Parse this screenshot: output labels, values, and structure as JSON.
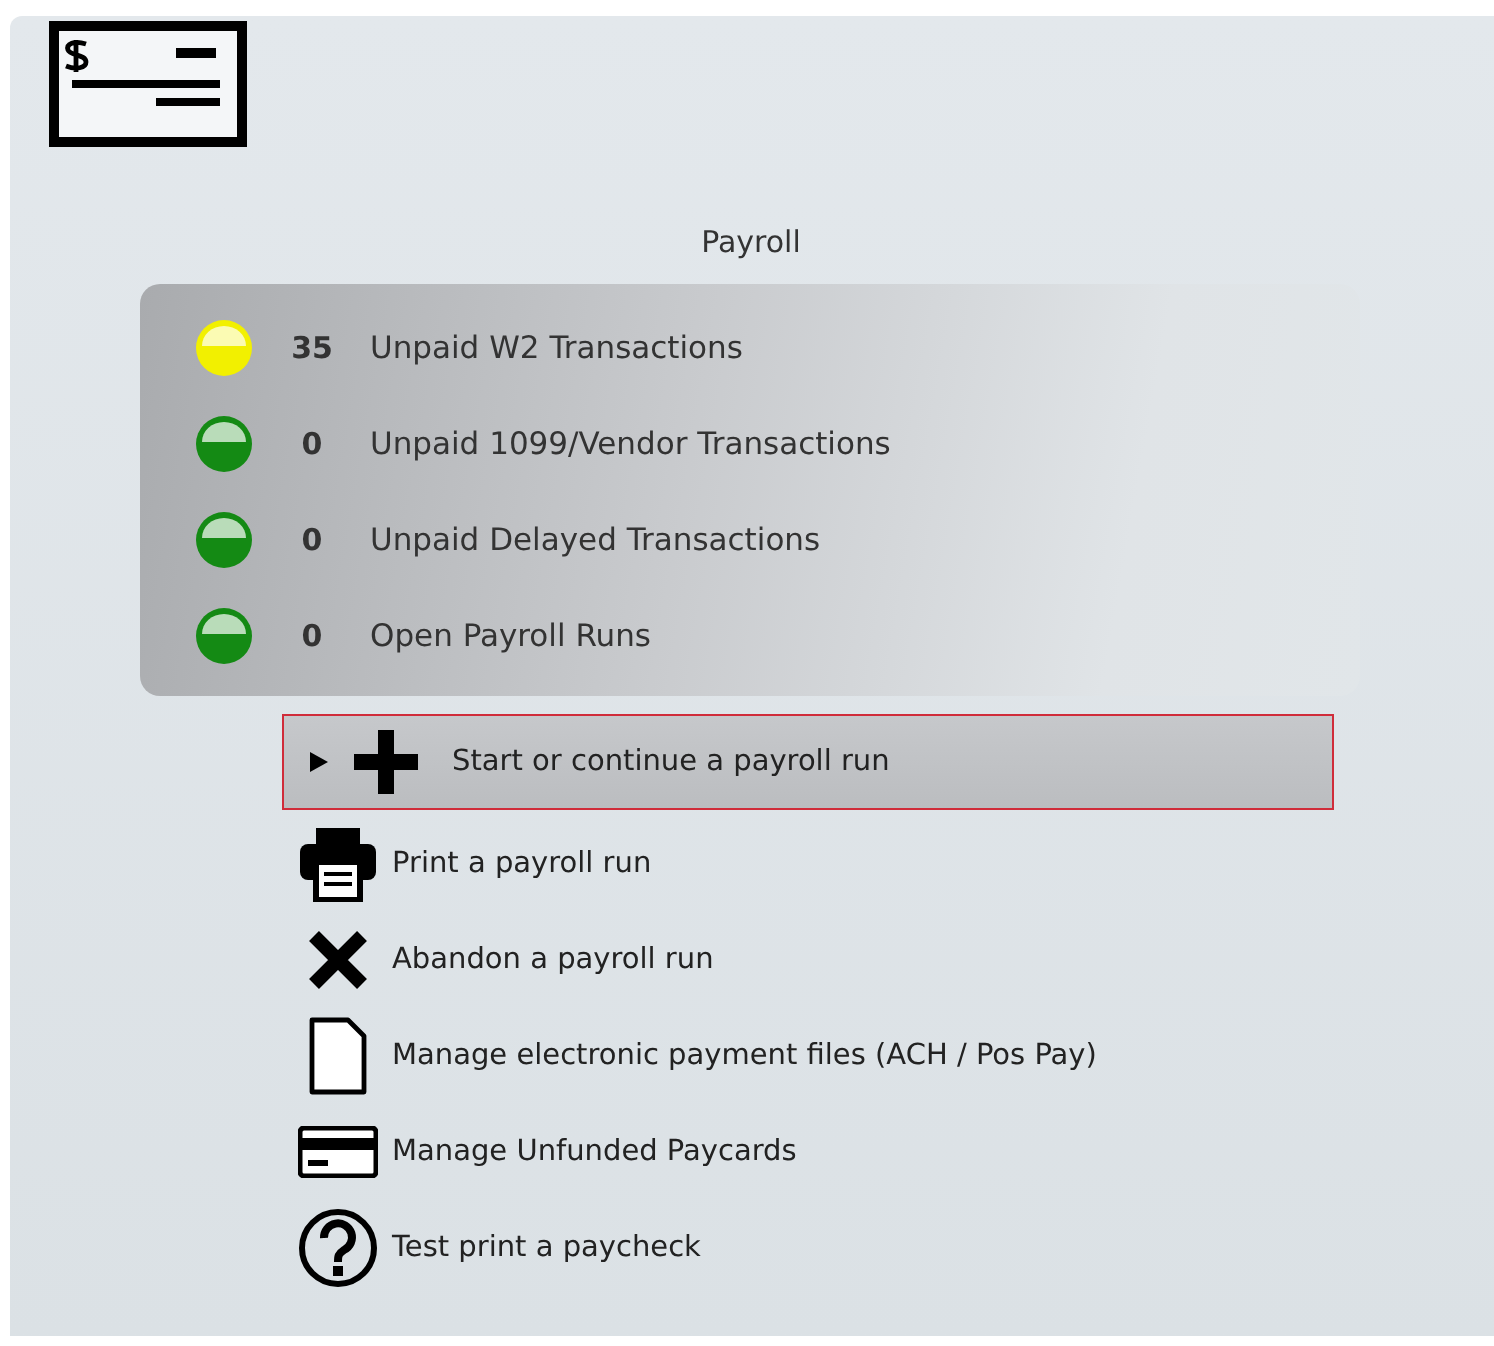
{
  "title": "Payroll",
  "status_items": [
    {
      "count": "35",
      "label": "Unpaid W2 Transactions",
      "color": "#f2f000"
    },
    {
      "count": "0",
      "label": "Unpaid 1099/Vendor Transactions",
      "color": "#148a14"
    },
    {
      "count": "0",
      "label": "Unpaid Delayed Transactions",
      "color": "#148a14"
    },
    {
      "count": "0",
      "label": "Open Payroll Runs",
      "color": "#148a14"
    }
  ],
  "actions": [
    {
      "kind": "plus",
      "label": "Start or continue a payroll run",
      "selected": true
    },
    {
      "kind": "printer",
      "label": "Print a payroll run",
      "selected": false
    },
    {
      "kind": "cross",
      "label": "Abandon a payroll run",
      "selected": false
    },
    {
      "kind": "document",
      "label": "Manage electronic payment files (ACH / Pos Pay)",
      "selected": false
    },
    {
      "kind": "card",
      "label": "Manage Unfunded Paycards",
      "selected": false
    },
    {
      "kind": "question",
      "label": "Test print a paycheck",
      "selected": false
    }
  ]
}
